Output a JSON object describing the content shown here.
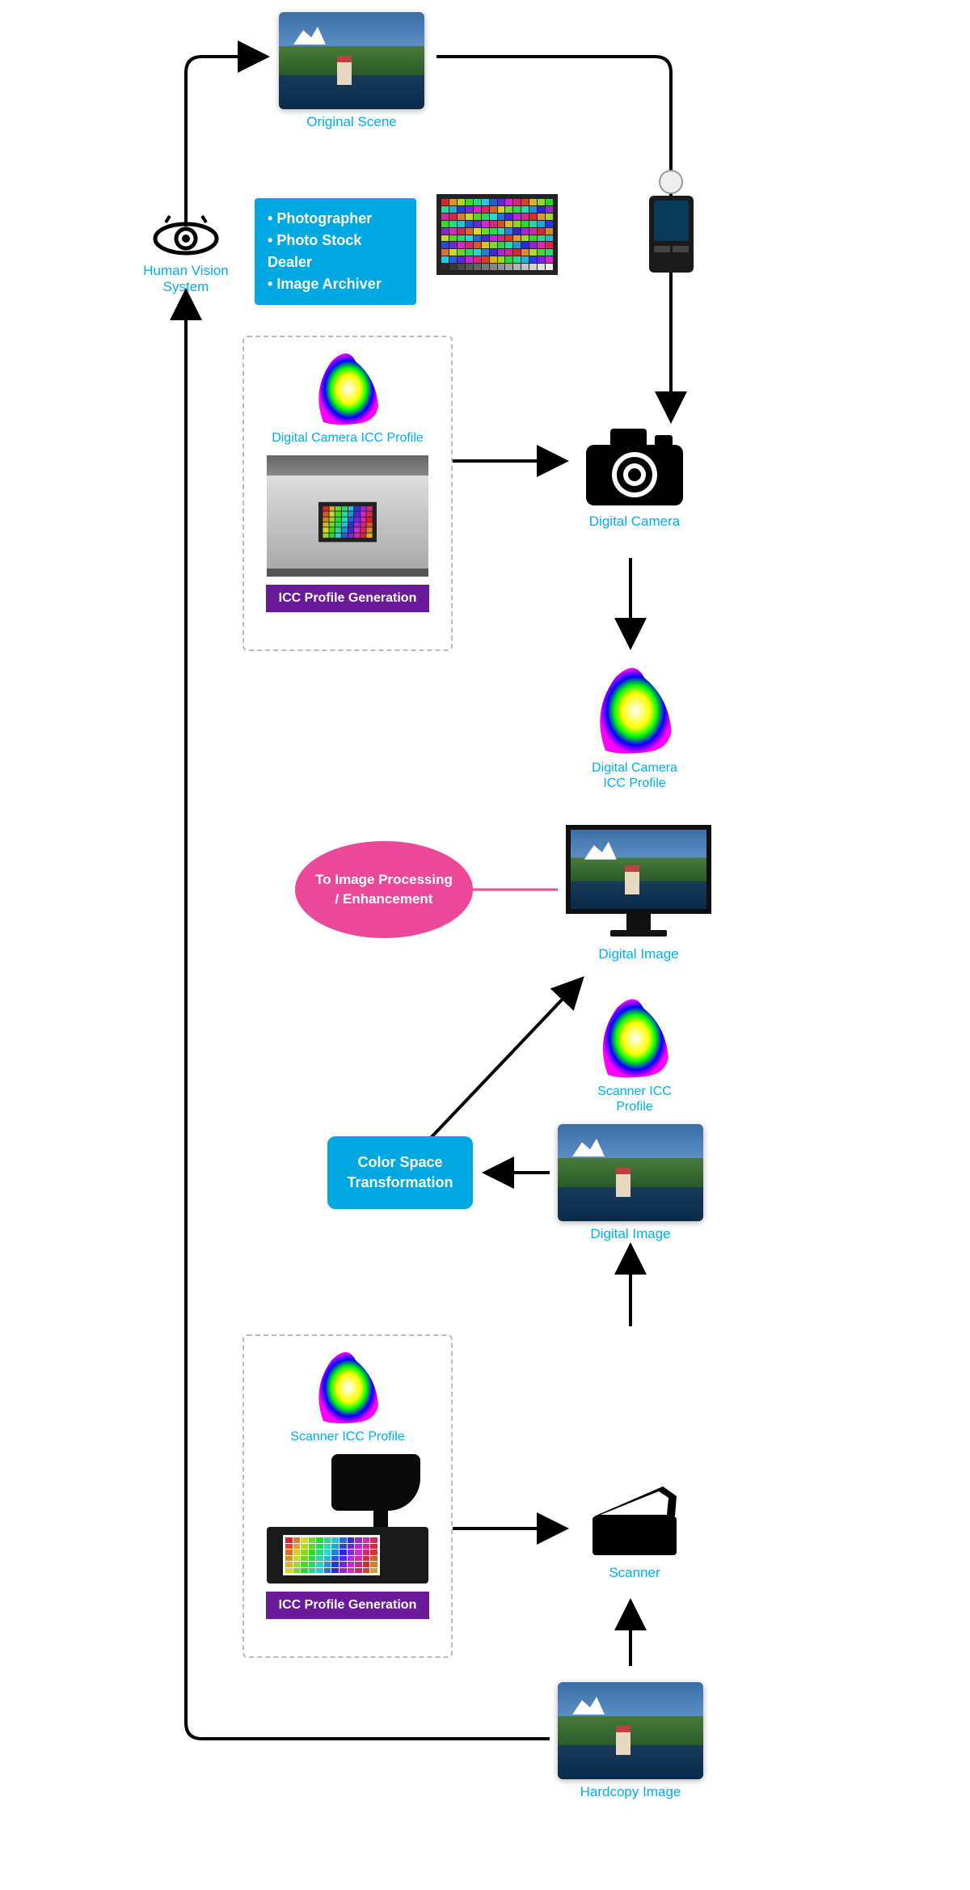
{
  "labels": {
    "human_vision": "Human Vision System",
    "original_scene": "Original Scene",
    "digital_camera_profile": "Digital Camera ICC Profile",
    "digital_camera": "Digital Camera",
    "digital_camera_profile2": "Digital Camera ICC Profile",
    "digital_image": "Digital Image",
    "scanner_profile": "Scanner ICC Profile",
    "digital_image2": "Digital Image",
    "scanner_profile2": "Scanner ICC Profile",
    "scanner": "Scanner",
    "hardcopy": "Hardcopy Image"
  },
  "roles": {
    "items": [
      "Photographer",
      "Photo Stock Dealer",
      "Image Archiver"
    ]
  },
  "icc_gen1": "ICC Profile Generation",
  "icc_gen2": "ICC Profile Generation",
  "color_space": "Color Space Transformation",
  "pink": "To Image Processing / Enhancement"
}
